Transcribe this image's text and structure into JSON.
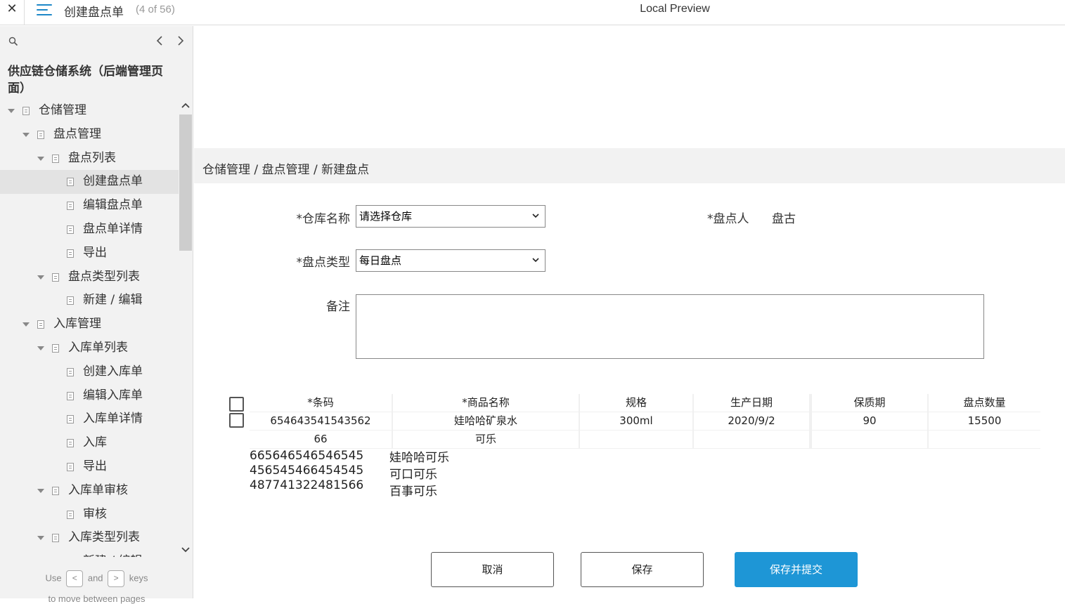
{
  "topbar": {
    "close_glyph": "✕",
    "page_name": "创建盘点单",
    "page_count": "(4 of 56)",
    "preview_title": "Local Preview"
  },
  "sidebar": {
    "project_title": "供应链仓储系统（后端管理页面）",
    "tree": [
      {
        "label": "仓储管理",
        "level": 0,
        "expanded": true
      },
      {
        "label": "盘点管理",
        "level": 1,
        "expanded": true
      },
      {
        "label": "盘点列表",
        "level": 2,
        "expanded": true
      },
      {
        "label": "创建盘点单",
        "level": 3,
        "selected": true
      },
      {
        "label": "编辑盘点单",
        "level": 3
      },
      {
        "label": "盘点单详情",
        "level": 3
      },
      {
        "label": "导出",
        "level": 3
      },
      {
        "label": "盘点类型列表",
        "level": 2,
        "expanded": true
      },
      {
        "label": "新建 / 编辑",
        "level": 3
      },
      {
        "label": "入库管理",
        "level": 1,
        "expanded": true
      },
      {
        "label": "入库单列表",
        "level": 2,
        "expanded": true
      },
      {
        "label": "创建入库单",
        "level": 3
      },
      {
        "label": "编辑入库单",
        "level": 3
      },
      {
        "label": "入库单详情",
        "level": 3
      },
      {
        "label": "入库",
        "level": 3
      },
      {
        "label": "导出",
        "level": 3
      },
      {
        "label": "入库单审核",
        "level": 2,
        "expanded": true
      },
      {
        "label": "审核",
        "level": 3
      },
      {
        "label": "入库类型列表",
        "level": 2,
        "expanded": true
      },
      {
        "label": "新建 / 编辑",
        "level": 3
      }
    ],
    "hint_use": "Use",
    "hint_prev_key": "<",
    "hint_and": "and",
    "hint_next_key": ">",
    "hint_keys": "keys",
    "hint_line2": "to move between pages"
  },
  "main": {
    "breadcrumb": "仓储管理 / 盘点管理 / 新建盘点",
    "form": {
      "warehouse_label": "*仓库名称",
      "warehouse_value": "请选择仓库",
      "counter_label": "*盘点人",
      "counter_value": "盘古",
      "type_label": "*盘点类型",
      "type_value": "每日盘点",
      "remark_label": "备注"
    },
    "table": {
      "headers": [
        "*条码",
        "*商品名称",
        "规格",
        "生产日期",
        "保质期",
        "盘点数量"
      ],
      "rows": [
        [
          "654643541543562",
          "娃哈哈矿泉水",
          "300ml",
          "2020/9/2",
          "90",
          "15500"
        ],
        [
          "66",
          "可乐",
          "",
          "",
          "",
          ""
        ]
      ]
    },
    "barcode_suggestions": [
      "665646546546545",
      "456545466454545",
      "487741322481566"
    ],
    "name_suggestions": [
      "娃哈哈可乐",
      "可口可乐",
      "百事可乐"
    ],
    "buttons": {
      "cancel": "取消",
      "save": "保存",
      "save_submit": "保存并提交"
    }
  },
  "colors": {
    "primary": "#1e96d6",
    "menu_icon": "#1e88c8",
    "sidebar_bg": "#f2f2f2"
  }
}
